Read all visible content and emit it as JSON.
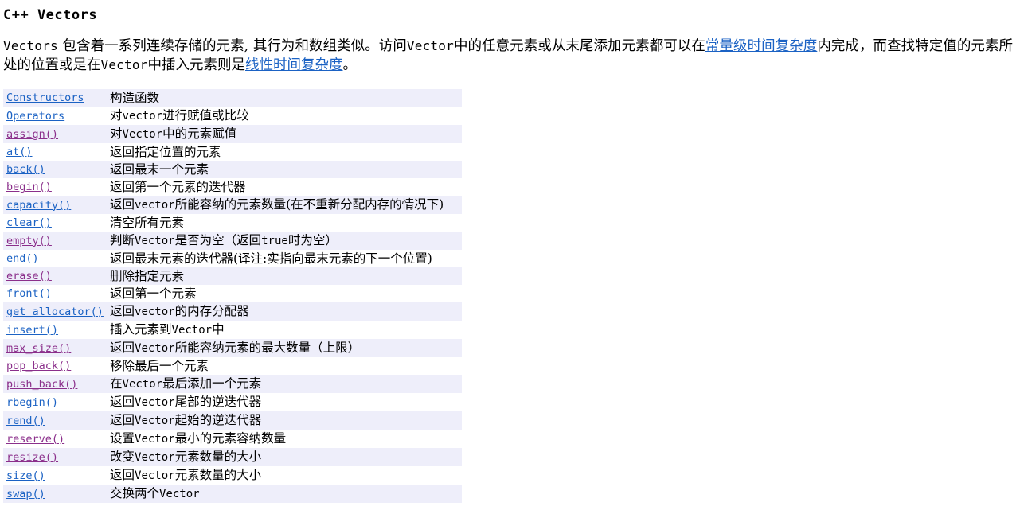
{
  "page": {
    "title": "C++ Vectors",
    "intro": {
      "segments": [
        {
          "kind": "mono",
          "text": "Vectors"
        },
        {
          "kind": "plain",
          "text": " 包含着一系列连续存储的元素, 其行为和数组类似。访问"
        },
        {
          "kind": "mono",
          "text": "Vector"
        },
        {
          "kind": "plain",
          "text": "中的任意元素或从末尾添加元素都可以在"
        },
        {
          "kind": "link",
          "text": "常量级时间复杂度"
        },
        {
          "kind": "plain",
          "text": "内完成，而查找特定值的元素所处的位置或是在"
        },
        {
          "kind": "mono",
          "text": "Vector"
        },
        {
          "kind": "plain",
          "text": "中插入元素则是"
        },
        {
          "kind": "link",
          "text": "线性时间复杂度"
        },
        {
          "kind": "plain",
          "text": "。"
        }
      ],
      "links": [
        "常量级时间复杂度",
        "线性时间复杂度"
      ]
    }
  },
  "colors": {
    "link_unvisited": "#1b62c4",
    "link_visited": "#8b2f8b",
    "row_stripe": "#eeeefa",
    "row_plain": "#ffffff",
    "text": "#000000",
    "background": "#ffffff"
  },
  "member_table": {
    "columns": [
      "name",
      "description"
    ],
    "rows": [
      {
        "name": "Constructors",
        "state": "unvisited",
        "striped": true,
        "description": "构造函数"
      },
      {
        "name": "Operators",
        "state": "unvisited",
        "striped": false,
        "description": "对vector进行赋值或比较"
      },
      {
        "name": "assign()",
        "state": "visited",
        "striped": true,
        "description": "对Vector中的元素赋值"
      },
      {
        "name": "at()",
        "state": "unvisited",
        "striped": false,
        "description": "返回指定位置的元素"
      },
      {
        "name": "back()",
        "state": "unvisited",
        "striped": true,
        "description": "返回最末一个元素"
      },
      {
        "name": "begin()",
        "state": "visited",
        "striped": false,
        "description": "返回第一个元素的迭代器"
      },
      {
        "name": "capacity()",
        "state": "unvisited",
        "striped": true,
        "description": "返回vector所能容纳的元素数量(在不重新分配内存的情况下)"
      },
      {
        "name": "clear()",
        "state": "unvisited",
        "striped": false,
        "description": "清空所有元素"
      },
      {
        "name": "empty()",
        "state": "visited",
        "striped": true,
        "description": "判断Vector是否为空（返回true时为空）"
      },
      {
        "name": "end()",
        "state": "unvisited",
        "striped": false,
        "description": "返回最末元素的迭代器(译注:实指向最末元素的下一个位置)"
      },
      {
        "name": "erase()",
        "state": "visited",
        "striped": true,
        "description": "删除指定元素"
      },
      {
        "name": "front()",
        "state": "unvisited",
        "striped": false,
        "description": "返回第一个元素"
      },
      {
        "name": "get_allocator()",
        "state": "unvisited",
        "striped": true,
        "description": "返回vector的内存分配器"
      },
      {
        "name": "insert()",
        "state": "unvisited",
        "striped": false,
        "description": "插入元素到Vector中"
      },
      {
        "name": "max_size()",
        "state": "visited",
        "striped": true,
        "description": "返回Vector所能容纳元素的最大数量（上限）"
      },
      {
        "name": "pop_back()",
        "state": "visited",
        "striped": false,
        "description": "移除最后一个元素"
      },
      {
        "name": "push_back()",
        "state": "visited",
        "striped": true,
        "description": "在Vector最后添加一个元素"
      },
      {
        "name": "rbegin()",
        "state": "unvisited",
        "striped": false,
        "description": "返回Vector尾部的逆迭代器"
      },
      {
        "name": "rend()",
        "state": "unvisited",
        "striped": true,
        "description": "返回Vector起始的逆迭代器"
      },
      {
        "name": "reserve()",
        "state": "visited",
        "striped": false,
        "description": "设置Vector最小的元素容纳数量"
      },
      {
        "name": "resize()",
        "state": "visited",
        "striped": true,
        "description": "改变Vector元素数量的大小"
      },
      {
        "name": "size()",
        "state": "unvisited",
        "striped": false,
        "description": "返回Vector元素数量的大小"
      },
      {
        "name": "swap()",
        "state": "unvisited",
        "striped": true,
        "description": "交换两个Vector"
      }
    ]
  }
}
